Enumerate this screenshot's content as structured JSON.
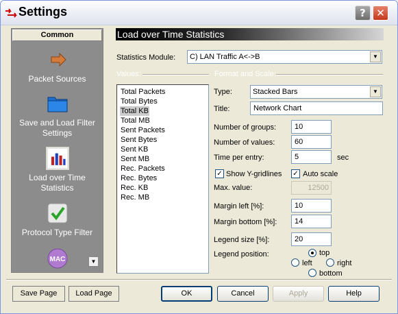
{
  "window": {
    "title": "Settings",
    "help_glyph": "?",
    "close_glyph": "✕"
  },
  "sidebar": {
    "header": "Common",
    "items": [
      {
        "label": "Packet Sources",
        "icon": "arrow-icon"
      },
      {
        "label": "Save and Load Filter Settings",
        "icon": "folder-icon"
      },
      {
        "label": "Load over Time Statistics",
        "icon": "bar-chart-icon"
      },
      {
        "label": "Protocol Type Filter",
        "icon": "checkmark-icon"
      },
      {
        "label": "MAC",
        "icon": "mac-icon"
      }
    ],
    "scroll_glyph": "▼"
  },
  "panel": {
    "title": "Load over Time Statistics",
    "statistics_module_label": "Statistics Module:",
    "statistics_module_value": "C)  LAN Traffic A<->B",
    "values_group": "Values:",
    "format_group": "Format and Scale:",
    "values": [
      "Total Packets",
      "Total Bytes",
      "Total KB",
      "Total MB",
      "Sent Packets",
      "Sent Bytes",
      "Sent KB",
      "Sent MB",
      "Rec. Packets",
      "Rec. Bytes",
      "Rec. KB",
      "Rec. MB"
    ],
    "selected_value": "Total KB",
    "type_label": "Type:",
    "type_value": "Stacked Bars",
    "title_label": "Title:",
    "title_value": "Network Chart",
    "groups_label": "Number of groups:",
    "groups_value": "10",
    "values_label": "Number of values:",
    "values_value": "60",
    "time_label": "Time per entry:",
    "time_value": "5",
    "time_unit": "sec",
    "show_grid_label": "Show Y-gridlines",
    "show_grid_checked": true,
    "auto_scale_label": "Auto scale",
    "auto_scale_checked": true,
    "max_value_label": "Max. value:",
    "max_value": "12500",
    "margin_left_label": "Margin left [%]:",
    "margin_left_value": "10",
    "margin_bottom_label": "Margin bottom [%]:",
    "margin_bottom_value": "14",
    "legend_size_label": "Legend size [%]:",
    "legend_size_value": "20",
    "legend_position_label": "Legend position:",
    "legend_position": {
      "top": "top",
      "left": "left",
      "right": "right",
      "bottom": "bottom",
      "selected": "top"
    },
    "check_glyph": "✓"
  },
  "buttons": {
    "save_page": "Save Page",
    "load_page": "Load Page",
    "ok": "OK",
    "cancel": "Cancel",
    "apply": "Apply",
    "help": "Help"
  }
}
